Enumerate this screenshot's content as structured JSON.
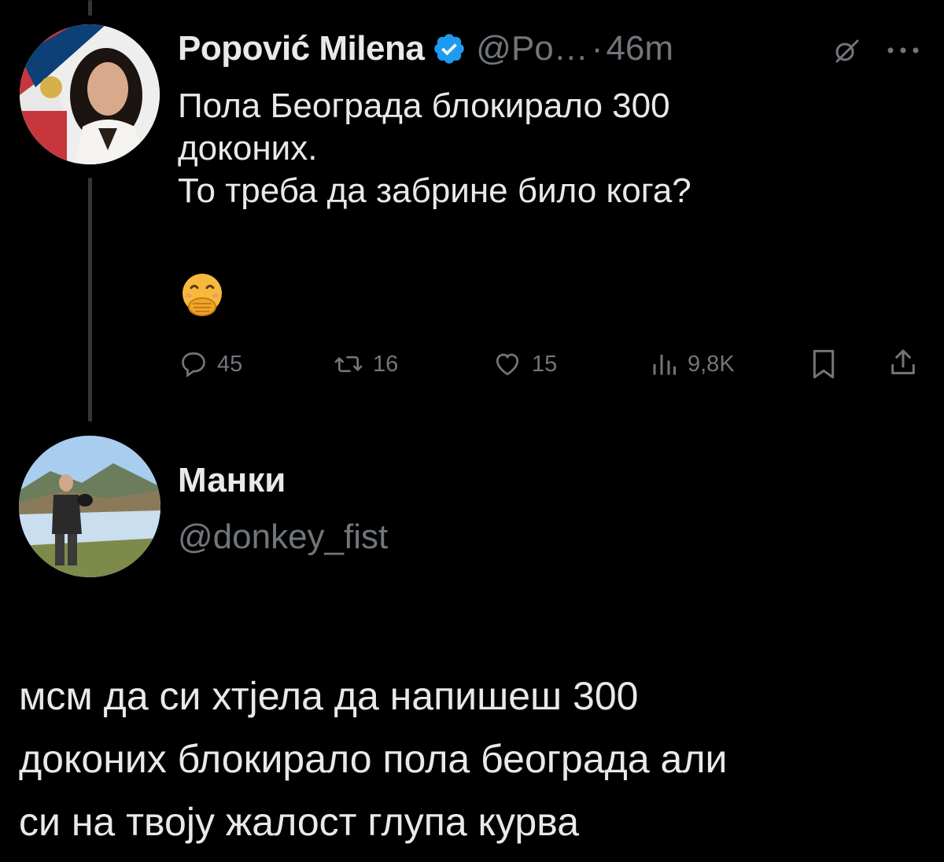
{
  "tweet": {
    "author_name": "Popović Milena",
    "handle": "@Po…",
    "separator": "·",
    "time": "46m",
    "lines": [
      "Пола Београда блокирало 300",
      "доконих.",
      "То треба да забрине било кога?"
    ],
    "emoji": "face-with-hand-over-mouth",
    "metrics": {
      "replies": "45",
      "retweets": "16",
      "likes": "15",
      "views": "9,8K"
    },
    "icons": [
      "verified-badge-icon",
      "grok-icon",
      "more-icon",
      "reply-icon",
      "retweet-icon",
      "like-icon",
      "views-icon",
      "bookmark-icon",
      "share-icon"
    ],
    "verified_color": "#1d9bf0"
  },
  "reply": {
    "author_name": "Манки",
    "handle": "@donkey_fist",
    "lines": [
      "мсм да си хтјела да напишеш 300",
      "доконих блокирало пола београда али",
      "си на твоју жалост глупа курва"
    ]
  },
  "colors": {
    "background": "#000000",
    "text": "#e7e9ea",
    "secondary": "#71767b",
    "thread_line": "#333639"
  }
}
